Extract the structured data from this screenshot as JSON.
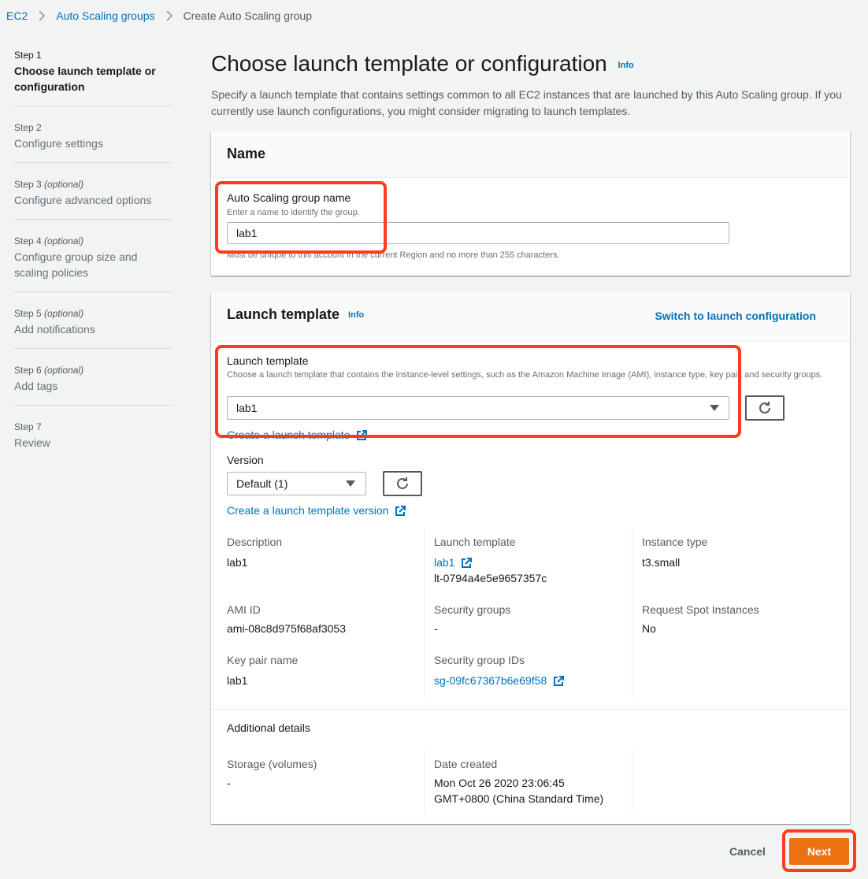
{
  "breadcrumb": {
    "items": [
      "EC2",
      "Auto Scaling groups"
    ],
    "current": "Create Auto Scaling group"
  },
  "steps": [
    {
      "num": "Step 1",
      "optional": "",
      "title": "Choose launch template or configuration",
      "active": true
    },
    {
      "num": "Step 2",
      "optional": "",
      "title": "Configure settings",
      "active": false
    },
    {
      "num": "Step 3",
      "optional": "(optional)",
      "title": "Configure advanced options",
      "active": false
    },
    {
      "num": "Step 4",
      "optional": "(optional)",
      "title": "Configure group size and scaling policies",
      "active": false
    },
    {
      "num": "Step 5",
      "optional": "(optional)",
      "title": "Add notifications",
      "active": false
    },
    {
      "num": "Step 6",
      "optional": "(optional)",
      "title": "Add tags",
      "active": false
    },
    {
      "num": "Step 7",
      "optional": "",
      "title": "Review",
      "active": false
    }
  ],
  "header": {
    "title": "Choose launch template or configuration",
    "info": "Info",
    "description": "Specify a launch template that contains settings common to all EC2 instances that are launched by this Auto Scaling group. If you currently use launch configurations, you might consider migrating to launch templates."
  },
  "name_panel": {
    "title": "Name",
    "field_label": "Auto Scaling group name",
    "field_hint": "Enter a name to identify the group.",
    "field_value": "lab1",
    "constraint": "Must be unique to this account in the current Region and no more than 255 characters."
  },
  "template_panel": {
    "title": "Launch template",
    "info": "Info",
    "switch_link": "Switch to launch configuration",
    "field_label": "Launch template",
    "field_hint": "Choose a launch template that contains the instance-level settings, such as the Amazon Machine Image (AMI), instance type, key pair, and security groups.",
    "selected": "lab1",
    "create_link": "Create a launch template",
    "version_label": "Version",
    "version_selected": "Default (1)",
    "create_version_link": "Create a launch template version",
    "details": {
      "description_label": "Description",
      "description_value": "lab1",
      "lt_label": "Launch template",
      "lt_link": "lab1",
      "lt_id": "lt-0794a4e5e9657357c",
      "instance_type_label": "Instance type",
      "instance_type_value": "t3.small",
      "ami_label": "AMI ID",
      "ami_value": "ami-08c8d975f68af3053",
      "sg_label": "Security groups",
      "sg_value": "-",
      "spot_label": "Request Spot Instances",
      "spot_value": "No",
      "keypair_label": "Key pair name",
      "keypair_value": "lab1",
      "sg_ids_label": "Security group IDs",
      "sg_ids_link": "sg-09fc67367b6e69f58"
    },
    "additional": {
      "title": "Additional details",
      "storage_label": "Storage (volumes)",
      "storage_value": "-",
      "date_label": "Date created",
      "date_line1": "Mon Oct 26 2020 23:06:45",
      "date_line2": "GMT+0800 (China Standard Time)"
    }
  },
  "footer": {
    "cancel": "Cancel",
    "next": "Next"
  },
  "colors": {
    "accent": "#0073bb",
    "primary_button": "#ec7211",
    "highlight": "#ff3b1f"
  }
}
